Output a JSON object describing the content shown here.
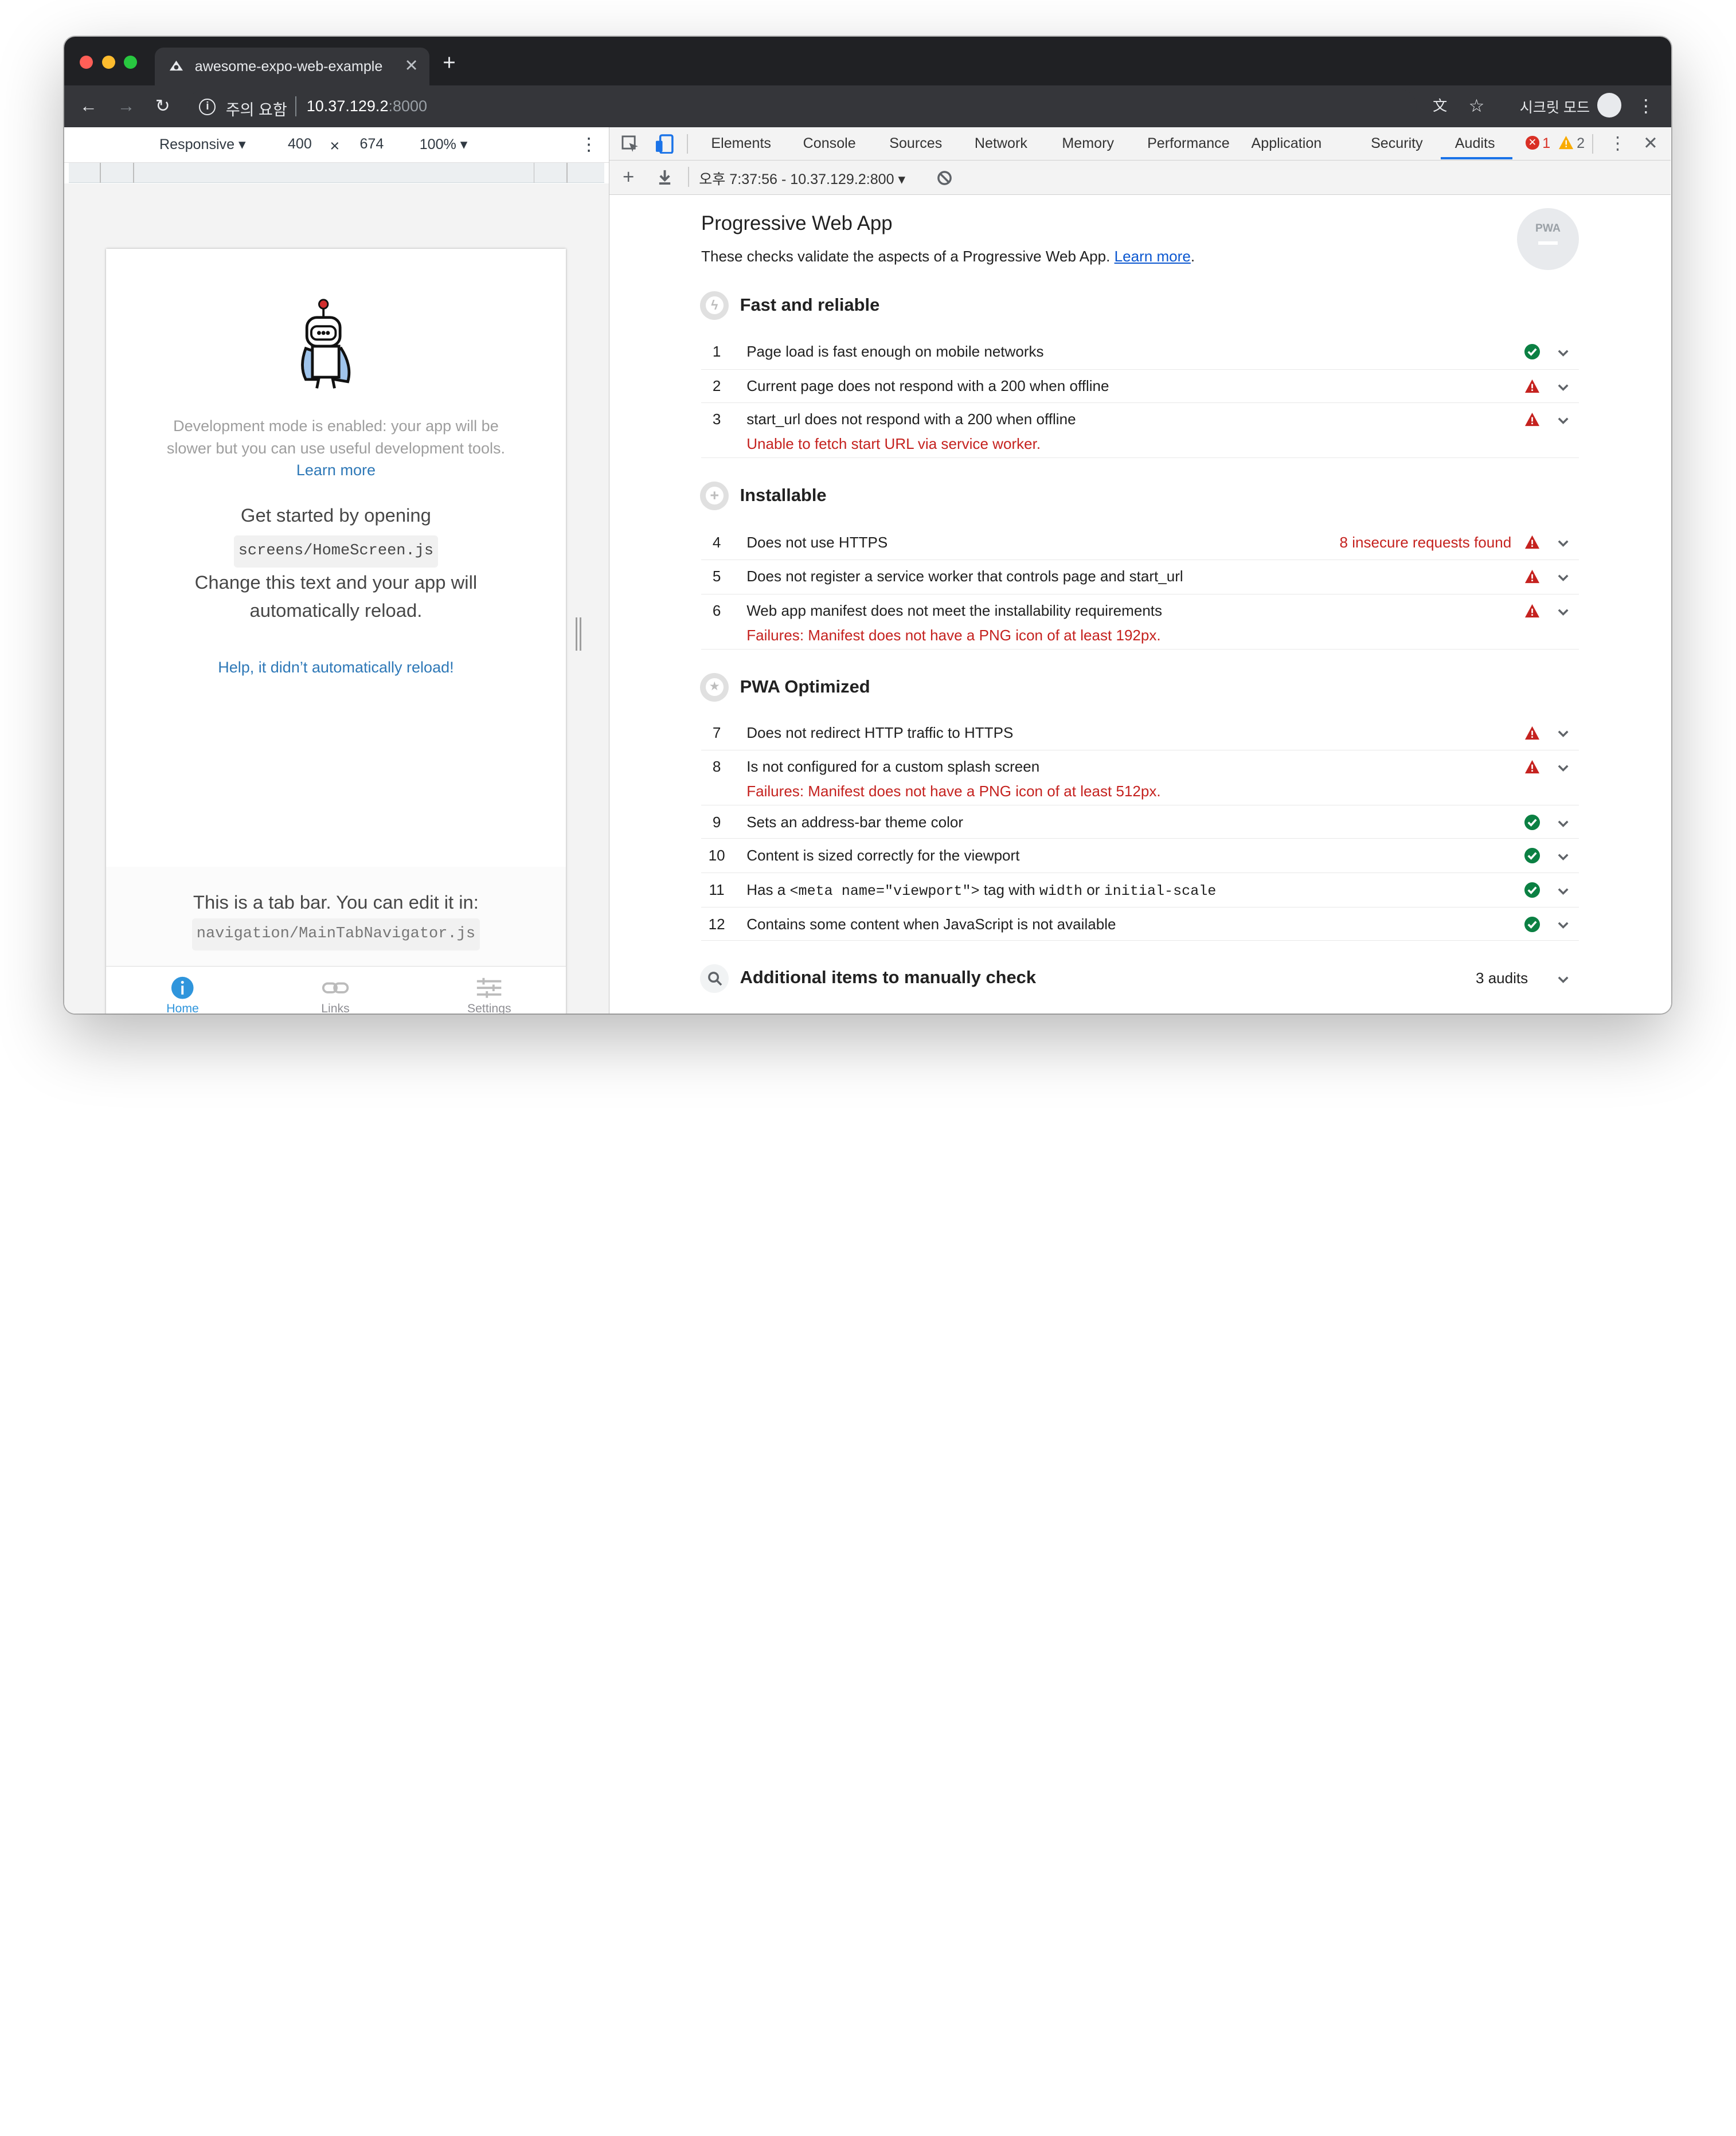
{
  "browser": {
    "tab_title": "awesome-expo-web-example",
    "security_label": "주의 요함",
    "url_host": "10.37.129.2",
    "url_port": ":8000",
    "incognito_label": "시크릿 모드"
  },
  "emulation": {
    "device": "Responsive ▾",
    "width": "400",
    "times": "×",
    "height": "674",
    "zoom": "100% ▾"
  },
  "app": {
    "dev_notice": "Development mode is enabled: your app will be slower but you can use useful development tools.",
    "dev_link": "Learn more",
    "get_started": "Get started by opening",
    "file_path": "screens/HomeScreen.js",
    "change_text": "Change this text and your app will automatically reload.",
    "help_link": "Help, it didn’t automatically reload!",
    "tabbar_text": "This is a tab bar. You can edit it in:",
    "tabbar_path": "navigation/MainTabNavigator.js",
    "tabs": [
      {
        "label": "Home",
        "color": "#2f95dc"
      },
      {
        "label": "Links",
        "color": "#ccc"
      },
      {
        "label": "Settings",
        "color": "#ccc"
      }
    ]
  },
  "devtools": {
    "tabs": [
      "Elements",
      "Console",
      "Sources",
      "Network",
      "Memory",
      "Performance",
      "Application",
      "Security",
      "Audits"
    ],
    "selected_tab": "Audits",
    "errors": "1",
    "warnings": "2",
    "report_selector": "오후 7:37:56 - 10.37.129.2:800 ▾"
  },
  "report": {
    "title": "Progressive Web App",
    "description": "These checks validate the aspects of a Progressive Web App.",
    "learn_more": "Learn more",
    "badge": "PWA",
    "groups": [
      {
        "title": "Fast and reliable",
        "icon": "lightning-icon"
      },
      {
        "title": "Installable",
        "icon": "plus-icon"
      },
      {
        "title": "PWA Optimized",
        "icon": "star-icon"
      },
      {
        "title": "Additional items to manually check",
        "icon": "search-icon",
        "count": "3 audits"
      }
    ],
    "audits": [
      {
        "n": "1",
        "text": "Page load is fast enough on mobile networks",
        "status": "pass"
      },
      {
        "n": "2",
        "text": "Current page does not respond with a 200 when offline",
        "status": "fail"
      },
      {
        "n": "3",
        "text": "start_url does not respond with a 200 when offline",
        "status": "fail",
        "error": "Unable to fetch start URL via service worker."
      },
      {
        "n": "4",
        "text": "Does not use HTTPS",
        "status": "fail",
        "extra": "8 insecure requests found"
      },
      {
        "n": "5",
        "text": "Does not register a service worker that controls page and start_url",
        "status": "fail"
      },
      {
        "n": "6",
        "text": "Web app manifest does not meet the installability requirements",
        "status": "fail",
        "error": "Failures: Manifest does not have a PNG icon of at least 192px."
      },
      {
        "n": "7",
        "text": "Does not redirect HTTP traffic to HTTPS",
        "status": "fail"
      },
      {
        "n": "8",
        "text": "Is not configured for a custom splash screen",
        "status": "fail",
        "error": "Failures: Manifest does not have a PNG icon of at least 512px."
      },
      {
        "n": "9",
        "text": "Sets an address-bar theme color",
        "status": "pass"
      },
      {
        "n": "10",
        "text": "Content is sized correctly for the viewport",
        "status": "pass"
      },
      {
        "n": "11",
        "text_parts": [
          "Has a ",
          "<meta name=\"viewport\">",
          " tag with ",
          "width",
          " or ",
          "initial-scale"
        ],
        "status": "pass"
      },
      {
        "n": "12",
        "text": "Contains some content when JavaScript is not available",
        "status": "pass"
      }
    ]
  },
  "colors": {
    "pass": "#0b8043",
    "fail": "#c5221f",
    "accent": "#1a73e8"
  }
}
